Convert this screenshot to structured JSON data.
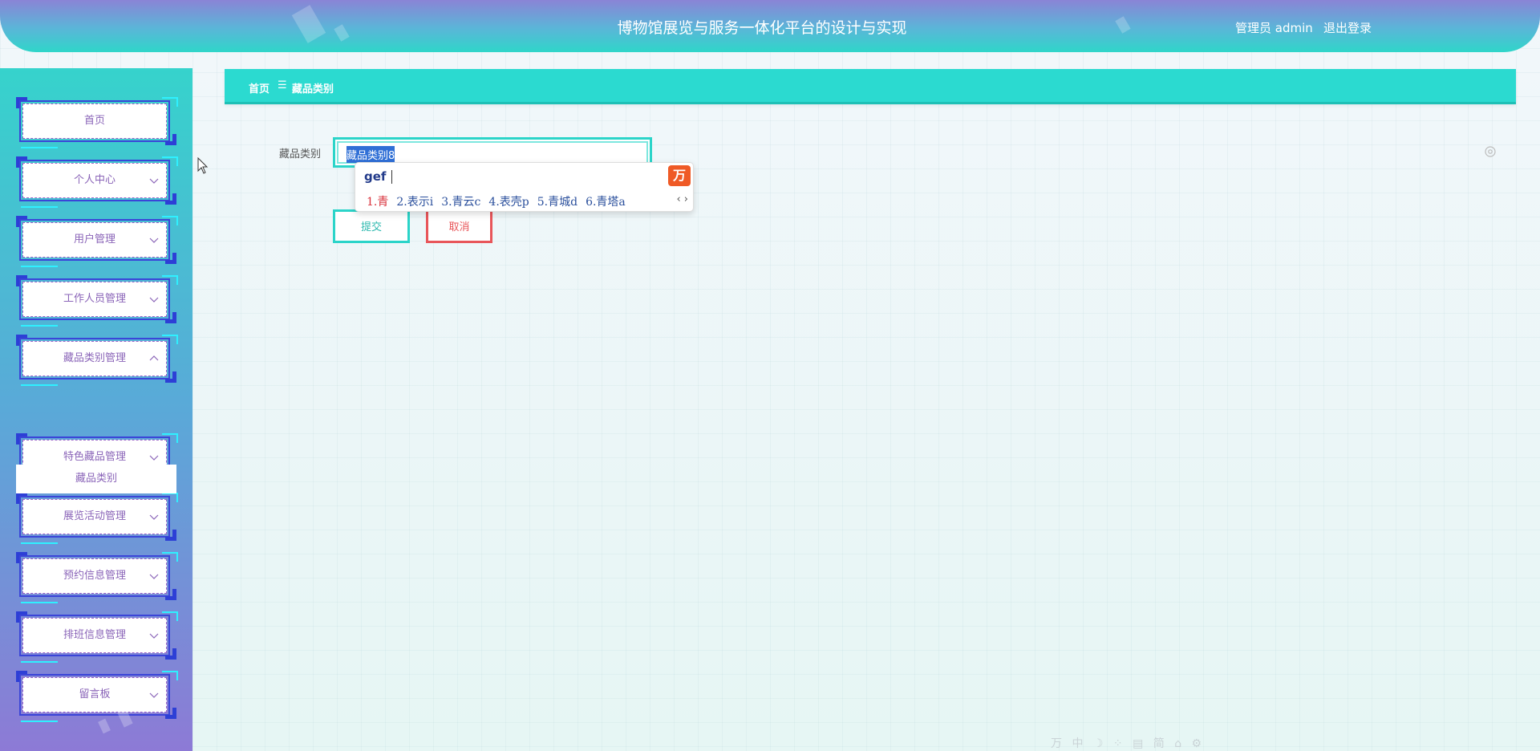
{
  "header": {
    "title": "博物馆展览与服务一体化平台的设计与实现",
    "user": "管理员 admin",
    "logout": "退出登录"
  },
  "sidebar": {
    "items": [
      {
        "label": "首页",
        "chevron": "none"
      },
      {
        "label": "个人中心",
        "chevron": "chevron-down-icon"
      },
      {
        "label": "用户管理",
        "chevron": "chevron-down-icon"
      },
      {
        "label": "工作人员管理",
        "chevron": "chevron-down-icon"
      },
      {
        "label": "藏品类别管理",
        "chevron": "chevron-up-icon"
      },
      {
        "label": "特色藏品管理",
        "chevron": "chevron-down-icon"
      },
      {
        "label": "展览活动管理",
        "chevron": "chevron-down-icon"
      },
      {
        "label": "预约信息管理",
        "chevron": "chevron-down-icon"
      },
      {
        "label": "排班信息管理",
        "chevron": "chevron-down-icon"
      },
      {
        "label": "留言板",
        "chevron": "chevron-down-icon"
      }
    ],
    "submenu": "藏品类别"
  },
  "breadcrumb": {
    "home": "首页",
    "separator": "☰",
    "current": "藏品类别"
  },
  "form": {
    "label": "藏品类别",
    "value": "藏品类别8",
    "submit": "提交",
    "cancel": "取消"
  },
  "ime": {
    "pinyin": "gef",
    "logo": "万",
    "candidates": [
      "1.青",
      "2.表示i",
      "3.青云c",
      "4.表壳p",
      "5.青城d",
      "6.青塔a"
    ],
    "nav": "‹ ›"
  },
  "tray": "万 中 ☽ ⁘ ▤ 简 ⌂ ⚙",
  "colors": {
    "accent": "#2bdad0",
    "cancel": "#e8565a",
    "menu_text": "#8a64b8"
  }
}
